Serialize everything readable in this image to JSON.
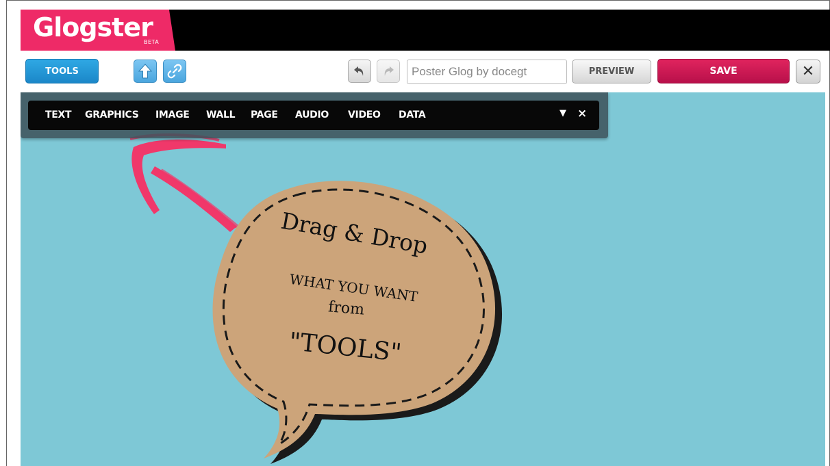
{
  "header": {
    "logo_text": "Glogster",
    "logo_badge": "BETA",
    "brand_color": "#ee2a67"
  },
  "toolbar": {
    "tools_label": "TOOLS",
    "upload_icon": "upload-arrow-icon",
    "link_icon": "chain-link-icon",
    "undo_icon": "undo-arrow-icon",
    "redo_icon": "redo-arrow-icon",
    "title_value": "Poster Glog by docegt",
    "preview_label": "PREVIEW",
    "save_label": "SAVE",
    "close_glyph": "✕",
    "save_color": "#c8174f",
    "tools_color": "#2596d6"
  },
  "tools_menu": {
    "items": [
      "TEXT",
      "GRAPHICS",
      "IMAGE",
      "WALL",
      "PAGE",
      "AUDIO",
      "VIDEO",
      "DATA"
    ],
    "dropdown_glyph": "▼",
    "close_glyph": "×"
  },
  "canvas": {
    "background_color": "#7ec8d6",
    "bubble": {
      "line1": "Drag & Drop",
      "line2": "WHAT YOU WANT",
      "line3": "from",
      "line4": "\"TOOLS\""
    },
    "arrow_color": "#f0386a"
  }
}
